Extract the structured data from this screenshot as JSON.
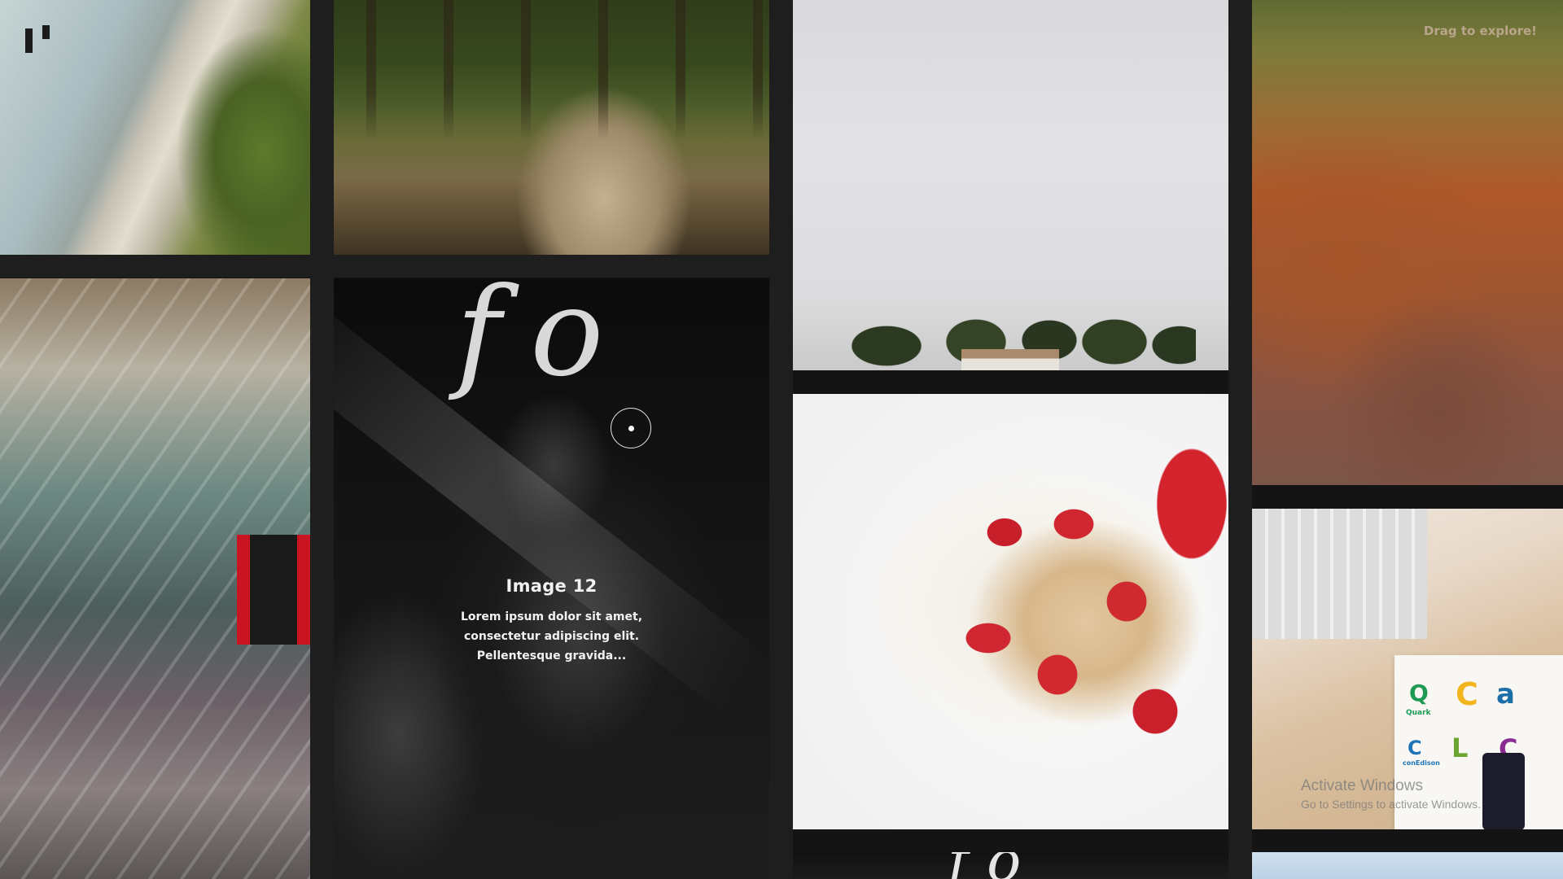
{
  "controls": {
    "pause_icon": "pause-icon",
    "drag_hint": "Drag to explore!"
  },
  "gallery": {
    "active_tile": {
      "title": "Image 12",
      "description": "Lorem ipsum dolor sit amet, consectetur adipiscing elit. Pellentesque gravida..."
    },
    "desk_logos": {
      "quark": "Quark",
      "conedison": "conEdison"
    }
  },
  "watermark": {
    "title": "Activate Windows",
    "subtitle": "Go to Settings to activate Windows."
  }
}
